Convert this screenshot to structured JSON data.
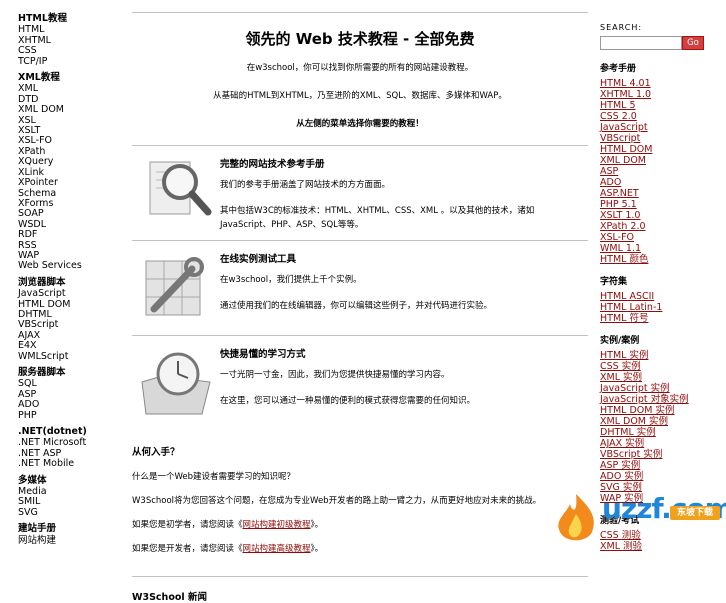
{
  "leftnav": {
    "groups": [
      {
        "title": "HTML教程",
        "items": [
          "HTML",
          "XHTML",
          "CSS",
          "TCP/IP"
        ]
      },
      {
        "title": "XML教程",
        "items": [
          "XML",
          "DTD",
          "XML DOM",
          "XSL",
          "XSLT",
          "XSL-FO",
          "XPath",
          "XQuery",
          "XLink",
          "XPointer",
          "Schema",
          "XForms",
          "SOAP",
          "WSDL",
          "RDF",
          "RSS",
          "WAP",
          "Web Services"
        ]
      },
      {
        "title": "浏览器脚本",
        "items": [
          "JavaScript",
          "HTML DOM",
          "DHTML",
          "VBScript",
          "AJAX",
          "E4X",
          "WMLScript"
        ]
      },
      {
        "title": "服务器脚本",
        "items": [
          "SQL",
          "ASP",
          "ADO",
          "PHP"
        ]
      },
      {
        "title": ".NET(dotnet)",
        "items": [
          ".NET Microsoft",
          ".NET ASP",
          ".NET Mobile"
        ]
      },
      {
        "title": "多媒体",
        "items": [
          "Media",
          "SMIL",
          "SVG"
        ]
      },
      {
        "title": "建站手册",
        "items": [
          "网站构建"
        ]
      }
    ]
  },
  "main": {
    "title": "领先的 Web 技术教程 - 全部免费",
    "intro1": "在w3school，你可以找到你所需要的所有的网站建设教程。",
    "intro2": "从基础的HTML到XHTML，乃至进阶的XML、SQL、数据库、多媒体和WAP。",
    "intro3": "从左侧的菜单选择你需要的教程！",
    "features": [
      {
        "title": "完整的网站技术参考手册",
        "t1": "我们的参考手册涵盖了网站技术的方方面面。",
        "t2": "其中包括W3C的标准技术：HTML、XHTML、CSS、XML 。以及其他的技术，诸如JavaScript、PHP、ASP、SQL等等。"
      },
      {
        "title": "在线实例测试工具",
        "t1": "在w3school，我们提供上千个实例。",
        "t2": "通过使用我们的在线编辑器，你可以编辑这些例子，并对代码进行实验。"
      },
      {
        "title": "快捷易懂的学习方式",
        "t1": "一寸光阴一寸金，因此，我们为您提供快捷易懂的学习内容。",
        "t2": "在这里，您可以通过一种易懂的便利的模式获得您需要的任何知识。"
      }
    ],
    "start": {
      "heading": "从何入手？",
      "p1": "什么是一个Web建设者需要学习的知识呢？",
      "p2": "W3School将为您回答这个问题，在您成为专业Web开发者的路上助一臂之力，从而更好地应对未来的挑战。",
      "p3_prefix": "如果您是初学者，请您阅读《",
      "p3_link": "网站构建初级教程",
      "p3_suffix": "》。",
      "p4_prefix": "如果您是开发者，请您阅读《",
      "p4_link": "网站构建高级教程",
      "p4_suffix": "》。"
    },
    "news_heading": "W3School 新闻"
  },
  "rightnav": {
    "search_label": "SEARCH:",
    "search_value": "",
    "go_label": "Go",
    "groups": [
      {
        "title": "参考手册",
        "items": [
          "HTML 4.01",
          "XHTML 1.0",
          "HTML 5",
          "CSS 2.0",
          "JavaScript",
          "VBScript",
          "HTML DOM",
          "XML DOM",
          "ASP",
          "ADO",
          "ASP.NET",
          "PHP 5.1",
          "XSLT 1.0",
          "XPath 2.0",
          "XSL-FO",
          "WML 1.1",
          "HTML 颜色"
        ]
      },
      {
        "title": "字符集",
        "items": [
          "HTML ASCII",
          "HTML Latin-1",
          "HTML 符号"
        ]
      },
      {
        "title": "实例/案例",
        "items": [
          "HTML 实例",
          "CSS 实例",
          "XML 实例",
          "JavaScript 实例",
          "JavaScript 对象实例",
          "HTML DOM 实例",
          "XML DOM 实例",
          "DHTML 实例",
          "AJAX 实例",
          "VBScript 实例",
          "ASP 实例",
          "ADO 实例",
          "SVG 实例",
          "WAP 实例"
        ]
      },
      {
        "title": "测验/考试",
        "items": [
          "CSS 测验",
          "XML 测验"
        ]
      }
    ]
  },
  "watermark": {
    "text": "uzzf.com",
    "badge": "东坡下载"
  }
}
